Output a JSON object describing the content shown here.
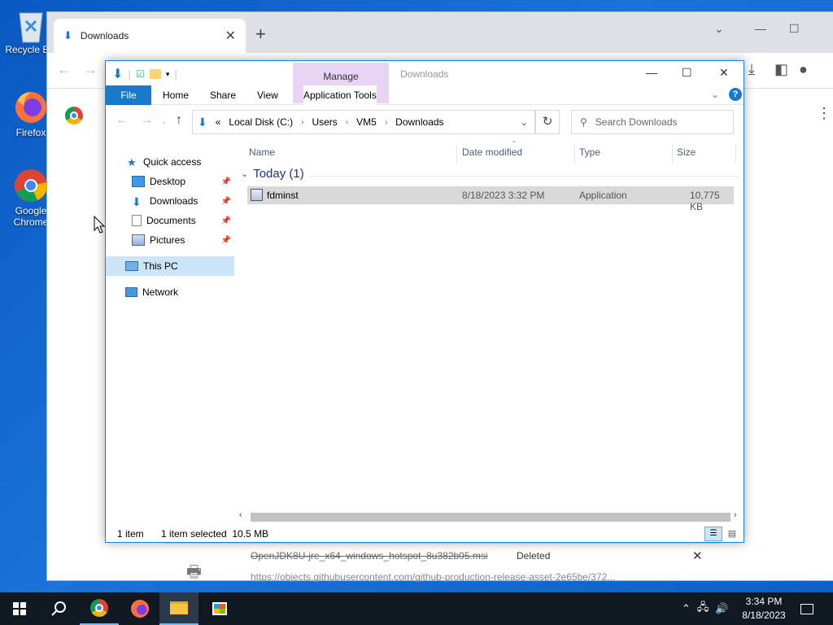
{
  "desktop": {
    "icons": [
      {
        "label": "Recycle Bin",
        "icon": "recycle-bin-icon"
      },
      {
        "label": "Firefox",
        "icon": "firefox-icon"
      },
      {
        "label": "Google Chrome",
        "icon": "chrome-icon"
      }
    ]
  },
  "chrome": {
    "tab_title": "Downloads",
    "download_item": {
      "filename": "OpenJDK8U-jre_x64_windows_hotspot_8u382b05.msi",
      "status": "Deleted",
      "url": "https://objects.githubusercontent.com/github-production-release-asset-2e65be/372..."
    }
  },
  "explorer": {
    "context_tab": "Manage",
    "window_title": "Downloads",
    "ribbon_tabs": [
      "File",
      "Home",
      "Share",
      "View",
      "Application Tools"
    ],
    "address": {
      "prefix": "«",
      "segments": [
        "Local Disk (C:)",
        "Users",
        "VM5",
        "Downloads"
      ]
    },
    "search_placeholder": "Search Downloads",
    "nav": {
      "quick_access": "Quick access",
      "items": [
        {
          "label": "Desktop",
          "pinned": true
        },
        {
          "label": "Downloads",
          "pinned": true
        },
        {
          "label": "Documents",
          "pinned": true
        },
        {
          "label": "Pictures",
          "pinned": true
        }
      ],
      "this_pc": "This PC",
      "network": "Network"
    },
    "columns": [
      "Name",
      "Date modified",
      "Type",
      "Size"
    ],
    "group": "Today (1)",
    "files": [
      {
        "name": "fdminst",
        "date_modified": "8/18/2023 3:32 PM",
        "type": "Application",
        "size": "10,775 KB"
      }
    ],
    "status": {
      "count": "1 item",
      "selection": "1 item selected  10.5 MB"
    }
  },
  "taskbar": {
    "time": "3:34 PM",
    "date": "8/18/2023"
  }
}
